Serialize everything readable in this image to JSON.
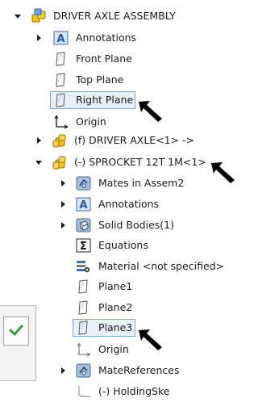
{
  "tree": {
    "root": {
      "label": "DRIVER AXLE ASSEMBLY",
      "icon": "assembly-icon",
      "expanded": true
    },
    "annotations": {
      "label": "Annotations",
      "icon": "annotations-icon"
    },
    "front_plane": {
      "label": "Front Plane",
      "icon": "plane-icon"
    },
    "top_plane": {
      "label": "Top Plane",
      "icon": "plane-icon"
    },
    "right_plane": {
      "label": "Right Plane",
      "icon": "plane-icon",
      "selected": true
    },
    "origin": {
      "label": "Origin",
      "icon": "origin-icon"
    },
    "driver_axle": {
      "label": "(f) DRIVER AXLE<1> ->",
      "icon": "part-icon"
    },
    "sprocket": {
      "label": "(-) SPROCKET 12T 1M<1>",
      "icon": "part-icon",
      "expanded": true
    },
    "children": {
      "mates": {
        "label": "Mates in Assem2",
        "icon": "mates-icon"
      },
      "annotations": {
        "label": "Annotations",
        "icon": "annotations-icon"
      },
      "solid_bodies": {
        "label": "Solid Bodies(1)",
        "icon": "solid-bodies-icon"
      },
      "equations": {
        "label": "Equations",
        "icon": "equations-icon"
      },
      "material": {
        "label": "Material <not specified>",
        "icon": "material-icon"
      },
      "plane1": {
        "label": "Plane1",
        "icon": "plane-icon"
      },
      "plane2": {
        "label": "Plane2",
        "icon": "plane-icon"
      },
      "plane3": {
        "label": "Plane3",
        "icon": "plane-icon",
        "selected": true
      },
      "origin": {
        "label": "Origin",
        "icon": "origin-icon"
      },
      "mate_references": {
        "label": "MateReferences",
        "icon": "mate-references-icon"
      },
      "holding_sketch": {
        "label": "(-) HoldingSke",
        "icon": "sketch-icon"
      }
    }
  },
  "colors": {
    "selection_border": "#7aa8dc",
    "selection_fill": "#e7f0fb",
    "part_yellow": "#f2c21a",
    "annotation_blue": "#3f69b3",
    "check_green": "#2f9b45"
  }
}
